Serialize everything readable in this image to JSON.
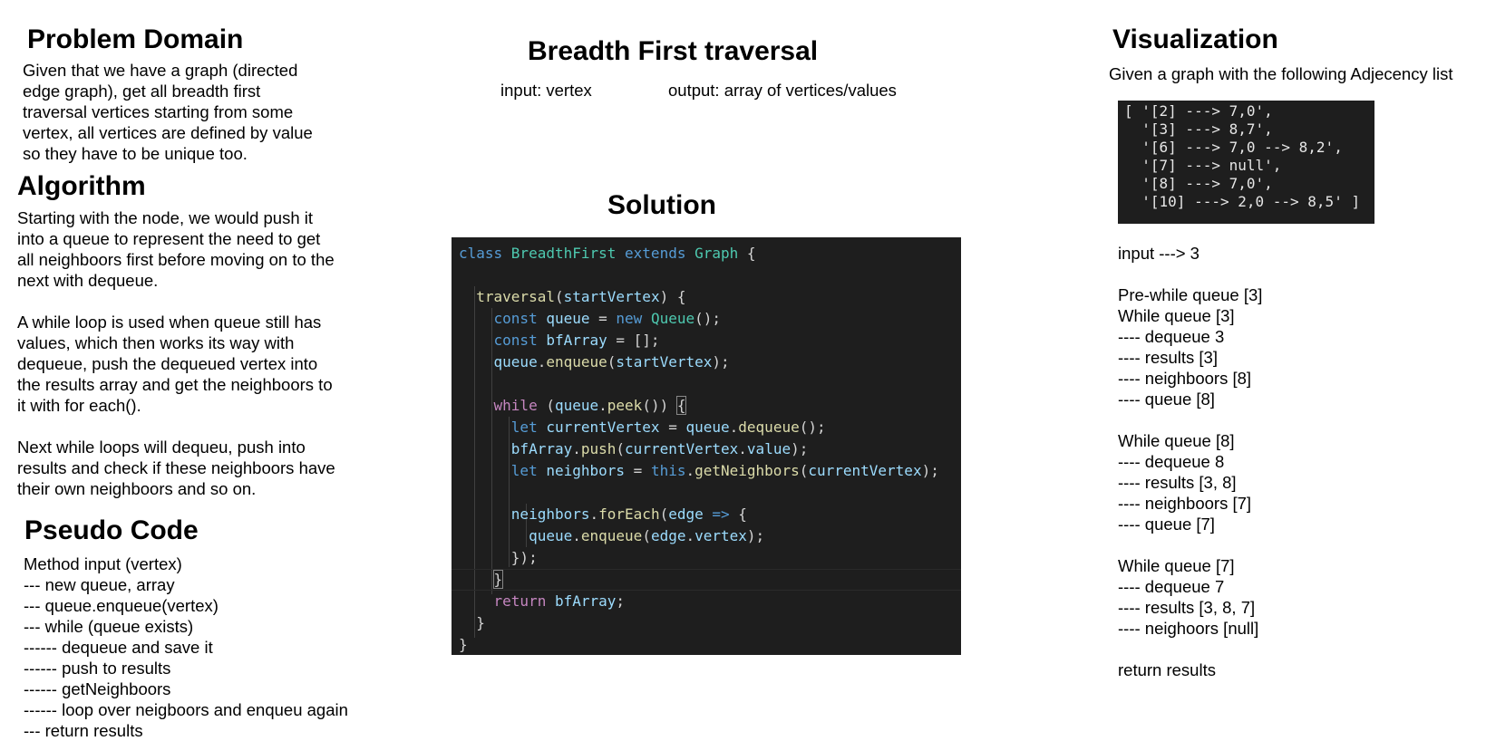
{
  "problem_domain": {
    "heading": "Problem Domain",
    "lines": [
      "Given that we have a graph (directed",
      "edge graph), get all breadth first",
      "traversal vertices starting from some",
      "vertex, all vertices are defined by value",
      "so they have to be unique too."
    ]
  },
  "algorithm": {
    "heading": "Algorithm",
    "lines": [
      "Starting with the node, we would push it",
      "into a queue to represent the need to get",
      "all neighboors first before moving on to the",
      "next with dequeue.",
      "",
      "A while loop is used when queue still has",
      "values, which then works its way with",
      "dequeue, push the dequeued vertex into",
      "the results array and get the neighboors to",
      "it with for each().",
      "",
      "Next while loops will dequeu, push into",
      "results and check if these neighboors have",
      "their own neighboors and so on."
    ]
  },
  "pseudo_code": {
    "heading": "Pseudo Code",
    "lines": [
      "Method input (vertex)",
      "--- new queue, array",
      "--- queue.enqueue(vertex)",
      "--- while (queue exists)",
      "------ dequeue and save it",
      "------ push to results",
      "------ getNeighboors",
      "------ loop over neigboors and enqueu again",
      "--- return results"
    ]
  },
  "title": {
    "heading": "Breadth First traversal",
    "input_label": "input: vertex",
    "output_label": "output: array of vertices/values"
  },
  "solution": {
    "heading": "Solution",
    "code": [
      [
        {
          "t": "class ",
          "c": "kw"
        },
        {
          "t": "BreadthFirst ",
          "c": "cls"
        },
        {
          "t": "extends ",
          "c": "kw"
        },
        {
          "t": "Graph ",
          "c": "cls"
        },
        {
          "t": "{",
          "c": "pl"
        }
      ],
      [],
      [
        {
          "t": "  "
        },
        {
          "t": "traversal",
          "c": "fn"
        },
        {
          "t": "(",
          "c": "pl"
        },
        {
          "t": "startVertex",
          "c": "var"
        },
        {
          "t": ") {",
          "c": "pl"
        }
      ],
      [
        {
          "t": "    "
        },
        {
          "t": "const ",
          "c": "kw"
        },
        {
          "t": "queue",
          "c": "var"
        },
        {
          "t": " = ",
          "c": "pl"
        },
        {
          "t": "new ",
          "c": "kw"
        },
        {
          "t": "Queue",
          "c": "cls"
        },
        {
          "t": "();",
          "c": "pl"
        }
      ],
      [
        {
          "t": "    "
        },
        {
          "t": "const ",
          "c": "kw"
        },
        {
          "t": "bfArray",
          "c": "var"
        },
        {
          "t": " = [];",
          "c": "pl"
        }
      ],
      [
        {
          "t": "    "
        },
        {
          "t": "queue",
          "c": "var"
        },
        {
          "t": ".",
          "c": "pl"
        },
        {
          "t": "enqueue",
          "c": "fn"
        },
        {
          "t": "(",
          "c": "pl"
        },
        {
          "t": "startVertex",
          "c": "var"
        },
        {
          "t": ");",
          "c": "pl"
        }
      ],
      [],
      [
        {
          "t": "    "
        },
        {
          "t": "while ",
          "c": "ctl"
        },
        {
          "t": "(",
          "c": "pl"
        },
        {
          "t": "queue",
          "c": "var"
        },
        {
          "t": ".",
          "c": "pl"
        },
        {
          "t": "peek",
          "c": "fn"
        },
        {
          "t": "()) ",
          "c": "pl"
        },
        {
          "t": "{",
          "c": "brk"
        }
      ],
      [
        {
          "t": "      "
        },
        {
          "t": "let ",
          "c": "kw"
        },
        {
          "t": "currentVertex",
          "c": "var"
        },
        {
          "t": " = ",
          "c": "pl"
        },
        {
          "t": "queue",
          "c": "var"
        },
        {
          "t": ".",
          "c": "pl"
        },
        {
          "t": "dequeue",
          "c": "fn"
        },
        {
          "t": "();",
          "c": "pl"
        }
      ],
      [
        {
          "t": "      "
        },
        {
          "t": "bfArray",
          "c": "var"
        },
        {
          "t": ".",
          "c": "pl"
        },
        {
          "t": "push",
          "c": "fn"
        },
        {
          "t": "(",
          "c": "pl"
        },
        {
          "t": "currentVertex",
          "c": "var"
        },
        {
          "t": ".",
          "c": "pl"
        },
        {
          "t": "value",
          "c": "var"
        },
        {
          "t": ");",
          "c": "pl"
        }
      ],
      [
        {
          "t": "      "
        },
        {
          "t": "let ",
          "c": "kw"
        },
        {
          "t": "neighbors",
          "c": "var"
        },
        {
          "t": " = ",
          "c": "pl"
        },
        {
          "t": "this",
          "c": "kw"
        },
        {
          "t": ".",
          "c": "pl"
        },
        {
          "t": "getNeighbors",
          "c": "fn"
        },
        {
          "t": "(",
          "c": "pl"
        },
        {
          "t": "currentVertex",
          "c": "var"
        },
        {
          "t": ");",
          "c": "pl"
        }
      ],
      [],
      [
        {
          "t": "      "
        },
        {
          "t": "neighbors",
          "c": "var"
        },
        {
          "t": ".",
          "c": "pl"
        },
        {
          "t": "forEach",
          "c": "fn"
        },
        {
          "t": "(",
          "c": "pl"
        },
        {
          "t": "edge",
          "c": "var"
        },
        {
          "t": " ",
          "c": "pl"
        },
        {
          "t": "=>",
          "c": "kw"
        },
        {
          "t": " {",
          "c": "pl"
        }
      ],
      [
        {
          "t": "        "
        },
        {
          "t": "queue",
          "c": "var"
        },
        {
          "t": ".",
          "c": "pl"
        },
        {
          "t": "enqueue",
          "c": "fn"
        },
        {
          "t": "(",
          "c": "pl"
        },
        {
          "t": "edge",
          "c": "var"
        },
        {
          "t": ".",
          "c": "pl"
        },
        {
          "t": "vertex",
          "c": "var"
        },
        {
          "t": ");",
          "c": "pl"
        }
      ],
      [
        {
          "t": "      "
        },
        {
          "t": "});",
          "c": "pl"
        }
      ],
      [
        {
          "t": "    "
        },
        {
          "t": "}",
          "c": "brk"
        }
      ],
      [
        {
          "t": "    "
        },
        {
          "t": "return ",
          "c": "ctl"
        },
        {
          "t": "bfArray",
          "c": "var"
        },
        {
          "t": ";",
          "c": "pl"
        }
      ],
      [
        {
          "t": "  "
        },
        {
          "t": "}",
          "c": "pl"
        }
      ],
      [
        {
          "t": "}",
          "c": "pl"
        }
      ]
    ]
  },
  "visualization": {
    "heading": "Visualization",
    "intro": "Given a graph with the following Adjecency list",
    "adjacency_list": [
      "[ '[2] ---> 7,0',",
      "  '[3] ---> 8,7',",
      "  '[6] ---> 7,0 --> 8,2',",
      "  '[7] ---> null',",
      "  '[8] ---> 7,0',",
      "  '[10] ---> 2,0 --> 8,5' ]"
    ],
    "trace": [
      "input ---> 3",
      "",
      "Pre-while queue [3]",
      "While queue [3]",
      "---- dequeue 3",
      "---- results [3]",
      "---- neighboors [8]",
      "---- queue [8]",
      "",
      "While queue [8]",
      "---- dequeue 8",
      "---- results [3, 8]",
      "---- neighboors [7]",
      "---- queue [7]",
      "",
      "While queue [7]",
      "---- dequeue 7",
      "---- results [3, 8, 7]",
      "---- neighoors [null]",
      "",
      "return results"
    ]
  },
  "colors": {
    "editor_bg": "#1e1e1e",
    "keyword": "#569cd6",
    "class_name": "#4ec9b0",
    "function": "#dcdcaa",
    "variable": "#9cdcfe",
    "control": "#c586c0",
    "punctuation": "#d4d4d4"
  }
}
